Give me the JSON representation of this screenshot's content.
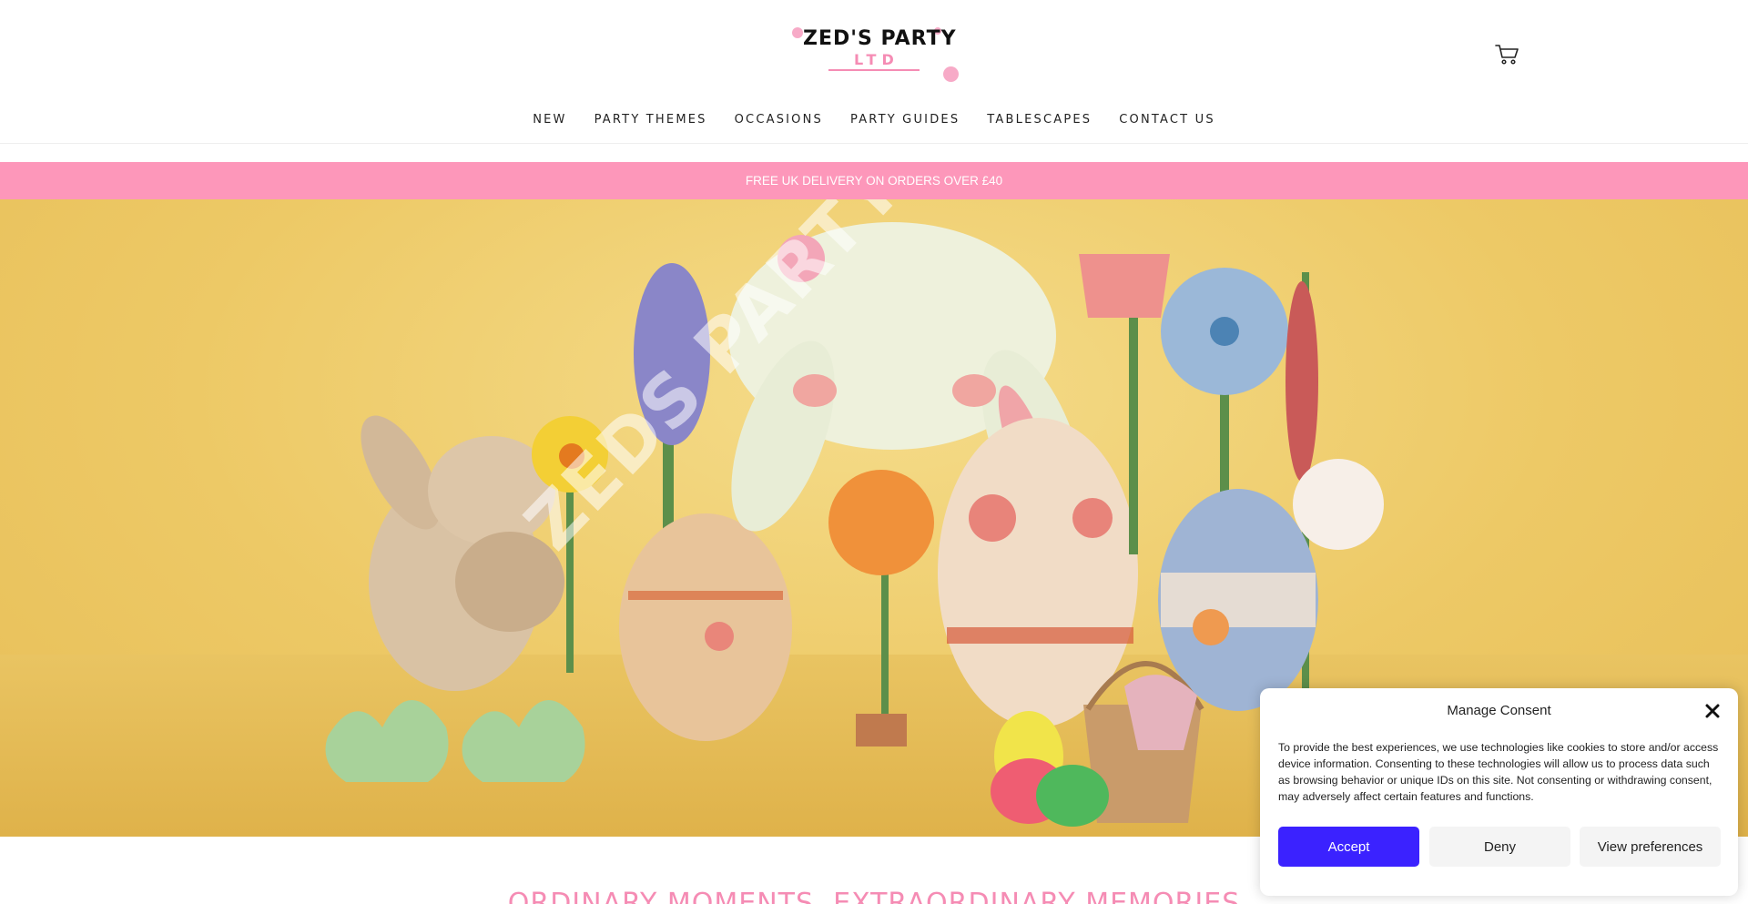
{
  "brand": {
    "name": "ZED'S PARTY",
    "sub": "LTD"
  },
  "nav": {
    "items": [
      "NEW",
      "PARTY THEMES",
      "OCCASIONS",
      "PARTY GUIDES",
      "TABLESCAPES",
      "CONTACT US"
    ]
  },
  "promo": {
    "text": "FREE UK DELIVERY ON ORDERS OVER £40"
  },
  "hero": {
    "watermark": "ZEDS PARTY LTD"
  },
  "tagline": "ORDINARY MOMENTS, EXTRAORDINARY MEMORIES",
  "consent": {
    "title": "Manage Consent",
    "text": "To provide the best experiences, we use technologies like cookies to store and/or access device information. Consenting to these technologies will allow us to process data such as browsing behavior or unique IDs on this site. Not consenting or withdrawing consent, may adversely affect certain features and functions.",
    "accept_label": "Accept",
    "deny_label": "Deny",
    "prefs_label": "View preferences"
  },
  "colors": {
    "accent_pink": "#fd97ba",
    "accept_blue": "#3b22ff",
    "hero_yellow": "#edc966"
  },
  "icons": {
    "cart": "cart-icon",
    "close": "close-icon"
  }
}
